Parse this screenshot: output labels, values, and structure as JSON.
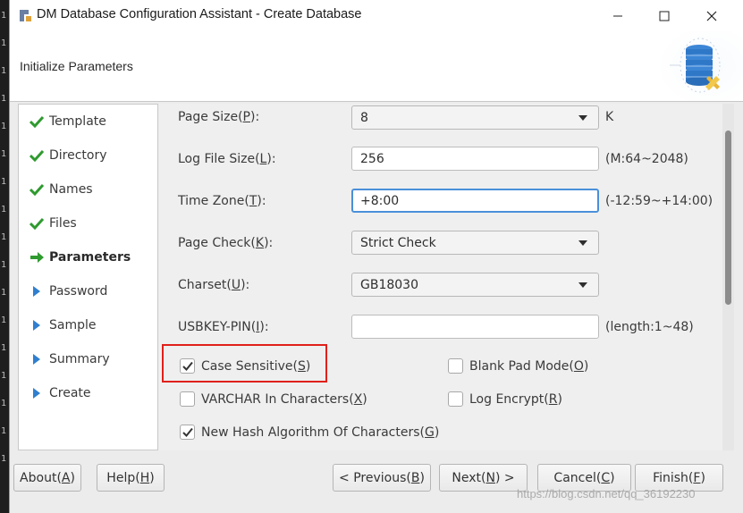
{
  "window": {
    "title": "DM Database Configuration Assistant - Create Database",
    "header_title": "Initialize Parameters"
  },
  "left_strip_chars": [
    "1",
    "1",
    "1",
    "1",
    "1",
    "1",
    "1",
    "1",
    "1",
    "1",
    "1",
    "1",
    "1",
    "1",
    "1",
    "1",
    "1"
  ],
  "nav": {
    "items": [
      {
        "label": "Template",
        "state": "done"
      },
      {
        "label": "Directory",
        "state": "done"
      },
      {
        "label": "Names",
        "state": "done"
      },
      {
        "label": "Files",
        "state": "done"
      },
      {
        "label": "Parameters",
        "state": "current"
      },
      {
        "label": "Password",
        "state": "pending"
      },
      {
        "label": "Sample",
        "state": "pending"
      },
      {
        "label": "Summary",
        "state": "pending"
      },
      {
        "label": "Create",
        "state": "pending"
      }
    ]
  },
  "form": {
    "page_size": {
      "label_pre": "Page Size(",
      "key": "P",
      "label_post": "):",
      "value": "8",
      "unit": "K"
    },
    "log_file_size": {
      "label_pre": "Log File Size(",
      "key": "L",
      "label_post": "):",
      "value": "256",
      "unit": "(M:64~2048)"
    },
    "time_zone": {
      "label_pre": "Time Zone(",
      "key": "T",
      "label_post": "):",
      "value": "+8:00",
      "unit": "(-12:59~+14:00)"
    },
    "page_check": {
      "label_pre": "Page Check(",
      "key": "K",
      "label_post": "):",
      "value": "Strict Check"
    },
    "charset": {
      "label_pre": "Charset(",
      "key": "U",
      "label_post": "):",
      "value": "GB18030"
    },
    "usbkey_pin": {
      "label_pre": "USBKEY-PIN(",
      "key": "I",
      "label_post": "):",
      "value": "",
      "unit": "(length:1~48)"
    },
    "case_sensitive": {
      "label_pre": "Case Sensitive(",
      "key": "S",
      "label_post": ")",
      "checked": true
    },
    "blank_pad_mode": {
      "label_pre": "Blank Pad Mode(",
      "key": "O",
      "label_post": ")",
      "checked": false
    },
    "varchar_in_chars": {
      "label_pre": "VARCHAR In Characters(",
      "key": "X",
      "label_post": ")",
      "checked": false
    },
    "log_encrypt": {
      "label_pre": "Log Encrypt(",
      "key": "R",
      "label_post": ")",
      "checked": false
    },
    "new_hash": {
      "label_pre": "New Hash Algorithm Of Characters(",
      "key": "G",
      "label_post": ")",
      "checked": true
    }
  },
  "buttons": {
    "about": {
      "pre": "About(",
      "key": "A",
      "post": ")"
    },
    "help": {
      "pre": "Help(",
      "key": "H",
      "post": ")"
    },
    "previous": {
      "pre": "< Previous(",
      "key": "B",
      "post": ")"
    },
    "next": {
      "pre": "Next(",
      "key": "N",
      "post": ") >"
    },
    "cancel": {
      "pre": "Cancel(",
      "key": "C",
      "post": ")"
    },
    "finish": {
      "pre": "Finish(",
      "key": "F",
      "post": ")"
    }
  },
  "watermark": "https://blog.csdn.net/qq_36192230",
  "colors": {
    "check_green": "#2f9a2f",
    "arrow_blue": "#2f7fd0",
    "highlight_red": "#e0201a",
    "focus_blue": "#4a90d9"
  }
}
